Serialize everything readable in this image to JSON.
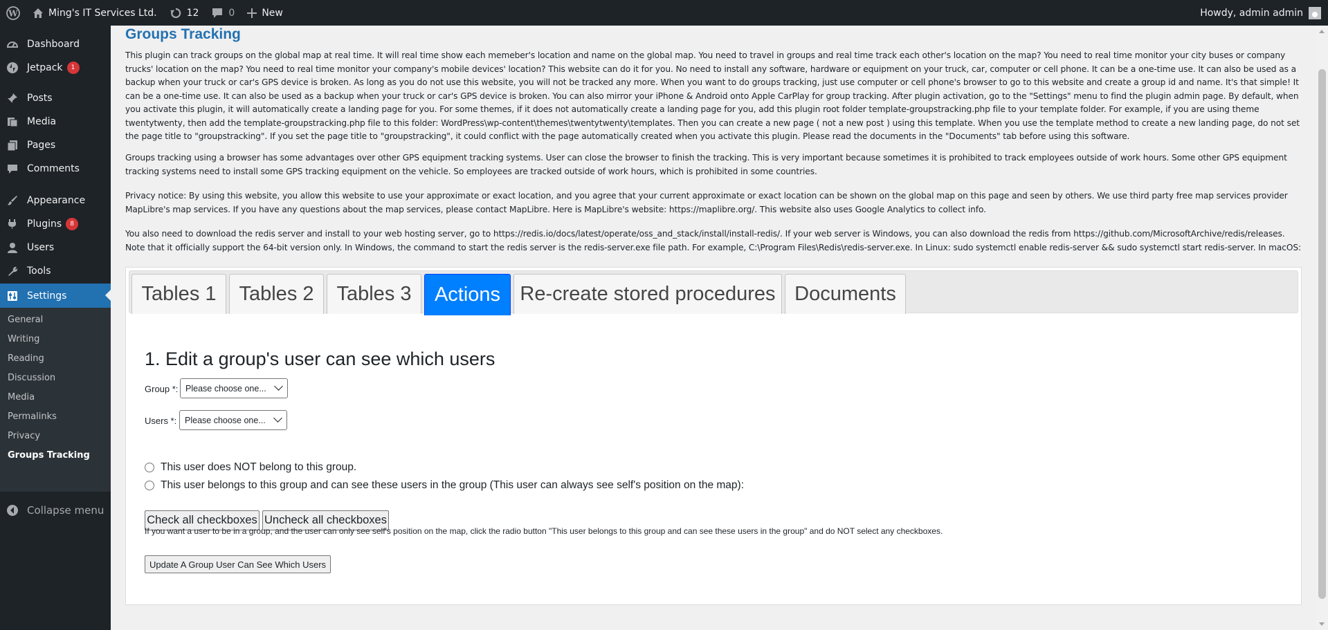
{
  "adminbar": {
    "site_name": "Ming's IT Services Ltd.",
    "updates_count": "12",
    "comments_count": "0",
    "new_label": "New",
    "howdy": "Howdy, admin admin"
  },
  "sidebar": {
    "items": [
      {
        "label": "Dashboard",
        "icon": "dashboard-icon"
      },
      {
        "label": "Jetpack",
        "icon": "jetpack-icon",
        "badge": "1"
      },
      {
        "label": "Posts",
        "icon": "pin-icon"
      },
      {
        "label": "Media",
        "icon": "media-icon"
      },
      {
        "label": "Pages",
        "icon": "pages-icon"
      },
      {
        "label": "Comments",
        "icon": "comments-icon"
      },
      {
        "label": "Appearance",
        "icon": "brush-icon"
      },
      {
        "label": "Plugins",
        "icon": "plugin-icon",
        "badge": "8"
      },
      {
        "label": "Users",
        "icon": "users-icon"
      },
      {
        "label": "Tools",
        "icon": "wrench-icon"
      },
      {
        "label": "Settings",
        "icon": "settings-icon"
      }
    ],
    "submenu": [
      "General",
      "Writing",
      "Reading",
      "Discussion",
      "Media",
      "Permalinks",
      "Privacy",
      "Groups Tracking"
    ],
    "collapse_label": "Collapse menu"
  },
  "page": {
    "title": "Groups Tracking",
    "p1": "This plugin can track groups on the global map at real time. It will real time show each memeber's location and name on the global map. You need to travel in groups and real time track each other's location on the map? You need to real time monitor your city buses or company trucks' location on the map? You need to real time monitor your company's mobile devices' location? This website can do it for you. No need to install any software, hardware or equipment on your truck, car, computer or cell phone. It can be a one-time use. It can also be used as a backup when your truck or car's GPS device is broken. As long as you do not use this website, you will not be tracked any more. When you want to do groups tracking, just use computer or cell phone's browser to go to this website and create a group id and name. It's that simple! It can be a one-time use. It can also be used as a backup when your truck or car's GPS device is broken. You can also mirror your iPhone & Android onto Apple CarPlay for group tracking. After plugin activation, go to the \"Settings\" menu to find the plugin admin page. By default, when you activate this plugin, it will automatically create a landing page for you. For some themes, if it does not automatically create a landing page for you, add this plugin root folder template-groupstracking.php file to your template folder. For example, if you are using theme twentytwenty, then add the template-groupstracking.php file to this folder: WordPress\\wp-content\\themes\\twentytwenty\\templates. Then you can create a new page ( not a new post ) using this template. When you use the template method to create a new landing page, do not set the page title to \"groupstracking\". If you set the page title to \"groupstracking\", it could conflict with the page automatically created when you activate this plugin. Please read the documents in the \"Documents\" tab before using this software.",
    "p2": "Groups tracking using a browser has some advantages over other GPS equipment tracking systems. User can close the browser to finish the tracking. This is very important because sometimes it is prohibited to track employees outside of work hours. Some other GPS equipment tracking systems need to install some GPS tracking equipment on the vehicle. So employees are tracked outside of work hours, which is prohibited in some countries.",
    "p3": "Privacy notice: By using this website, you allow this website to use your approximate or exact location, and you agree that your current approximate or exact location can be shown on the global map on this page and seen by others. We use third party free map services provider MapLibre's map services. If you have any questions about the map services, please contact MapLibre. Here is MapLibre's website: https://maplibre.org/. This website also uses Google Analytics to collect info.",
    "p4": "You also need to download the redis server and install to your web hosting server, go to https://redis.io/docs/latest/operate/oss_and_stack/install/install-redis/. If your web server is Windows, you can also download the redis from https://github.com/MicrosoftArchive/redis/releases. Note that it officially support the 64-bit version only. In Windows, the command to start the redis server is the redis-server.exe file path. For example, C:\\Program Files\\Redis\\redis-server.exe. In Linux: sudo systemctl enable redis-server && sudo systemctl start redis-server. In macOS: redis-server"
  },
  "tabs": [
    {
      "label": "Tables 1",
      "active": false
    },
    {
      "label": "Tables 2",
      "active": false
    },
    {
      "label": "Tables 3",
      "active": false
    },
    {
      "label": "Actions",
      "active": true
    },
    {
      "label": "Re-create stored procedures",
      "active": false
    },
    {
      "label": "Documents",
      "active": false
    }
  ],
  "actions": {
    "section_title": "1. Edit a group's user can see which users",
    "group_label": "Group *:",
    "group_value": "Please choose one...",
    "users_label": "Users *:",
    "users_value": "Please choose one...",
    "radio_not_belong": "This user does NOT belong to this group.",
    "radio_belongs": "This user belongs to this group and can see these users in the group (This user can always see self's position on the map):",
    "check_all": "Check all checkboxes",
    "uncheck_all": "Uncheck all checkboxes",
    "note": "If you want a user to be in a group, and the user can only see self's position on the map, click the radio button \"This user belongs to this group and can see these users in the group\" and do NOT select any checkboxes.",
    "update_button": "Update A Group User Can See Which Users"
  },
  "colors": {
    "admin_bg": "#1d2327",
    "accent": "#2271b1",
    "active_tab": "#007fff",
    "badge": "#d63638"
  }
}
